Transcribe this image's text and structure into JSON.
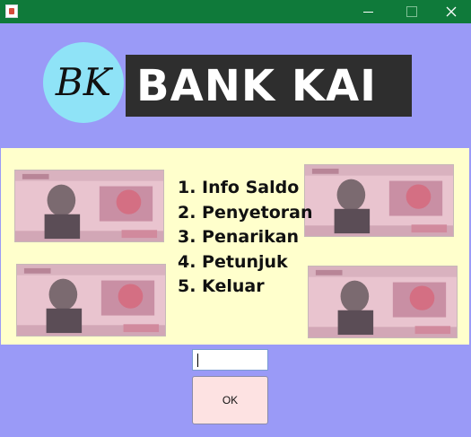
{
  "window": {
    "title": "",
    "controls": {
      "minimize": "minimize-icon",
      "maximize": "maximize-icon",
      "close": "close-icon"
    }
  },
  "logo": {
    "badge": "BK",
    "name": "BANK KAI"
  },
  "menu": {
    "items": [
      {
        "label": "1. Info Saldo"
      },
      {
        "label": "2. Penyetoran"
      },
      {
        "label": "3. Penarikan"
      },
      {
        "label": "4. Petunjuk"
      },
      {
        "label": "5. Keluar"
      }
    ]
  },
  "form": {
    "choice_value": "",
    "ok_label": "OK"
  },
  "colors": {
    "titlebar": "#0f7a3a",
    "background": "#9a9af7",
    "panel": "#ffffcc",
    "logo_circle": "#8fe3f7",
    "logo_bar": "#2e2e2e",
    "button": "#fde2e2"
  }
}
